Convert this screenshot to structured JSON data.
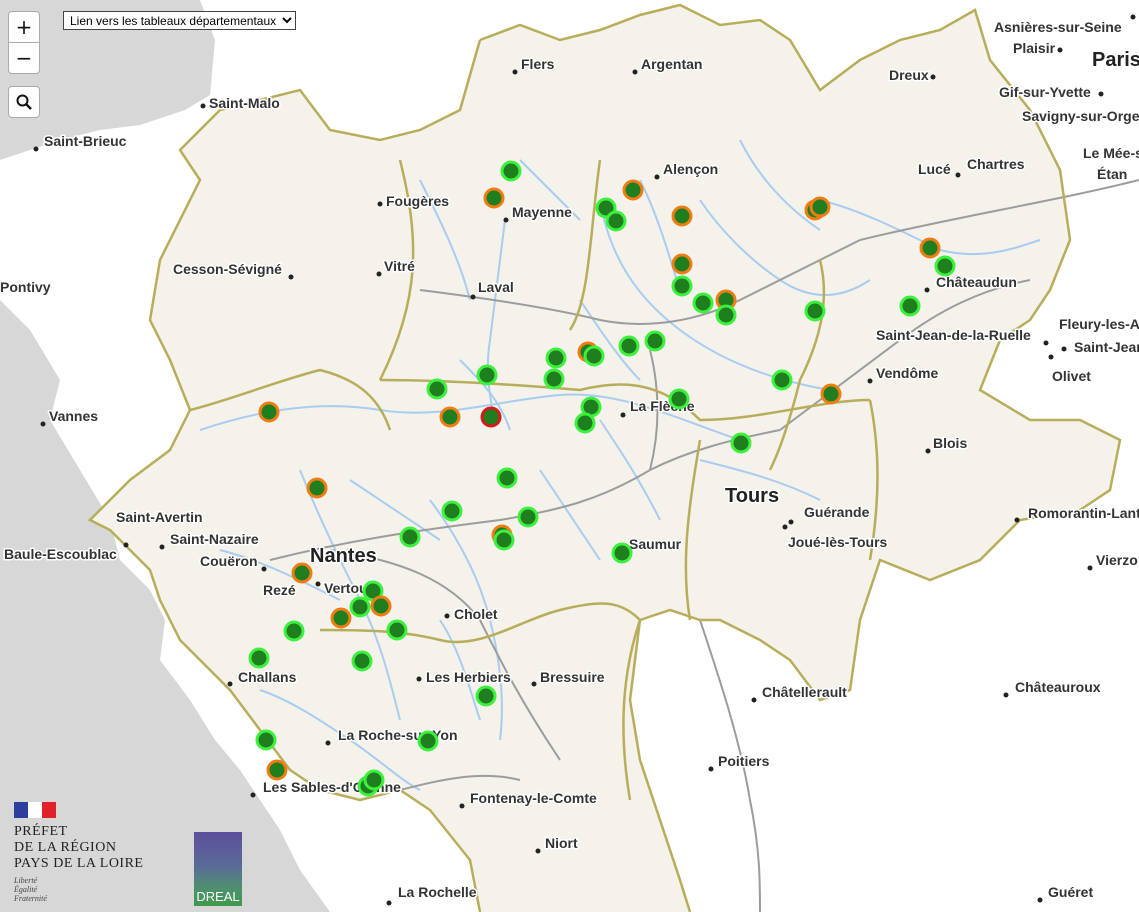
{
  "controls": {
    "zoom_in": "+",
    "zoom_out": "−",
    "search_icon": "search-icon",
    "department_select": "Lien vers les tableaux départementaux"
  },
  "cities": [
    {
      "name": "Flers",
      "big": false
    },
    {
      "name": "Argentan",
      "big": false
    },
    {
      "name": "Asnières-sur-Seine",
      "big": false
    },
    {
      "name": "Plaisir",
      "big": false
    },
    {
      "name": "Paris",
      "big": true
    },
    {
      "name": "Dreux",
      "big": false
    },
    {
      "name": "Gif-sur-Yvette",
      "big": false
    },
    {
      "name": "Savigny-sur-Orge",
      "big": false
    },
    {
      "name": "Saint-Malo",
      "big": false
    },
    {
      "name": "Saint-Brieuc",
      "big": false
    },
    {
      "name": "Alençon",
      "big": false
    },
    {
      "name": "Lucé",
      "big": false
    },
    {
      "name": "Chartres",
      "big": false
    },
    {
      "name": "Le Mée-s",
      "big": false
    },
    {
      "name": "Étan",
      "big": false
    },
    {
      "name": "Fougères",
      "big": false
    },
    {
      "name": "Mayenne",
      "big": false
    },
    {
      "name": "Cesson-Sévigné",
      "big": false
    },
    {
      "name": "Vitré",
      "big": false
    },
    {
      "name": "Pontivy",
      "big": false
    },
    {
      "name": "Laval",
      "big": false
    },
    {
      "name": "Châteaudun",
      "big": false
    },
    {
      "name": "Fleury-les-A",
      "big": false
    },
    {
      "name": "Saint-Jean-de-la-Ruelle",
      "big": false
    },
    {
      "name": "Saint-Jean",
      "big": false
    },
    {
      "name": "Olivet",
      "big": false
    },
    {
      "name": "Vendôme",
      "big": false
    },
    {
      "name": "Vannes",
      "big": false
    },
    {
      "name": "La Flèche",
      "big": false
    },
    {
      "name": "Blois",
      "big": false
    },
    {
      "name": "Tours",
      "big": true
    },
    {
      "name": "Guérande",
      "big": false
    },
    {
      "name": "Saint-Avertin",
      "big": false
    },
    {
      "name": "Romorantin-Lant",
      "big": false
    },
    {
      "name": "Saint-Nazaire",
      "big": false
    },
    {
      "name": "Baule-Escoublac",
      "big": false
    },
    {
      "name": "Nantes",
      "big": true
    },
    {
      "name": "Saumur",
      "big": false
    },
    {
      "name": "Joué-lès-Tours",
      "big": false
    },
    {
      "name": "Vierzo",
      "big": false
    },
    {
      "name": "Couëron",
      "big": false
    },
    {
      "name": "Rezé",
      "big": false
    },
    {
      "name": "Vertou",
      "big": false
    },
    {
      "name": "Cholet",
      "big": false
    },
    {
      "name": "Challans",
      "big": false
    },
    {
      "name": "Les Herbiers",
      "big": false
    },
    {
      "name": "Bressuire",
      "big": false
    },
    {
      "name": "Châtellerault",
      "big": false
    },
    {
      "name": "Châteauroux",
      "big": false
    },
    {
      "name": "La Roche-sur-Yon",
      "big": false
    },
    {
      "name": "Poitiers",
      "big": false
    },
    {
      "name": "Les Sables-d'Olonne",
      "big": false
    },
    {
      "name": "Fontenay-le-Comte",
      "big": false
    },
    {
      "name": "Niort",
      "big": false
    },
    {
      "name": "La Rochelle",
      "big": false
    },
    {
      "name": "Guéret",
      "big": false
    }
  ],
  "stations_summary": {
    "green": 44,
    "orange": 16,
    "red": 1
  },
  "colors": {
    "station_green_fill": "#1f7f1f",
    "station_green_ring": "#3df03d",
    "station_orange_ring": "#f07c14",
    "station_red_ring": "#d41a1a",
    "region_fill": "#f4f2ea",
    "boundary": "#b8ad5a",
    "river": "#a9ccf0",
    "sea": "#d7d7d7",
    "road": "#999999"
  },
  "logos": {
    "prefet_line1": "PRÉFET",
    "prefet_line2": "DE LA RÉGION",
    "prefet_line3": "PAYS DE LA LOIRE",
    "motto1": "Liberté",
    "motto2": "Égalité",
    "motto3": "Fraternité",
    "dreal": "DREAL"
  }
}
